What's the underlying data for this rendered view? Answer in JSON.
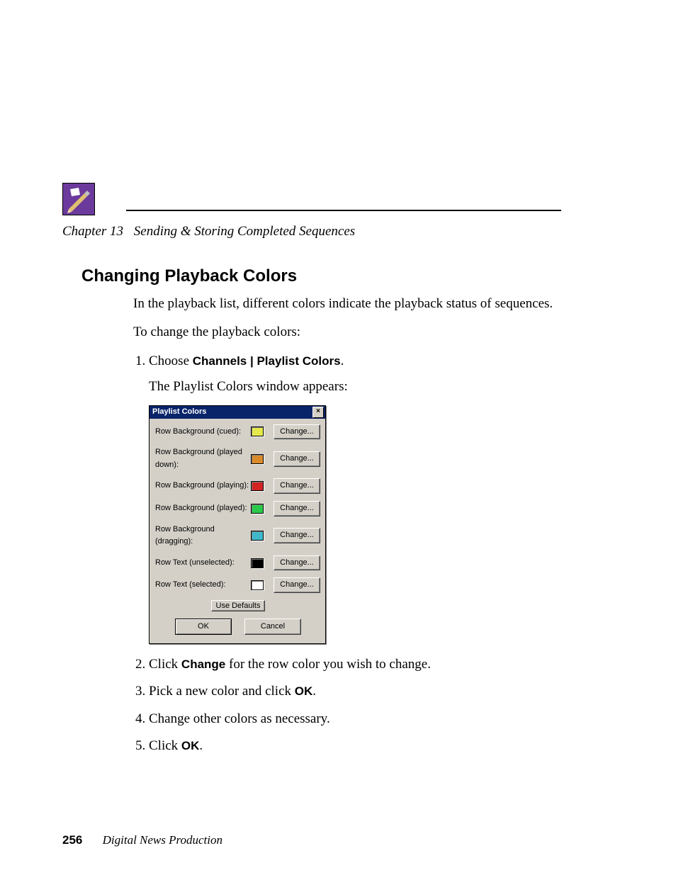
{
  "chapter": {
    "num": "Chapter 13",
    "title": "Sending & Storing Completed Sequences"
  },
  "heading": "Changing Playback Colors",
  "para1": "In the playback list, different colors indicate the playback status of sequences.",
  "para2": "To change the playback colors:",
  "steps": {
    "s1_prefix": "Choose ",
    "s1_bold": "Channels | Playlist Colors",
    "s1_suffix": ".",
    "s1_sub": "The Playlist Colors window appears:",
    "s2_prefix": "Click ",
    "s2_bold": "Change",
    "s2_suffix": " for the row color you wish to change.",
    "s3_prefix": "Pick a new color and click ",
    "s3_bold": "OK",
    "s3_suffix": ".",
    "s4": "Change other colors as necessary.",
    "s5_prefix": "Click ",
    "s5_bold": "OK",
    "s5_suffix": "."
  },
  "dialog": {
    "title": "Playlist Colors",
    "close": "×",
    "change": "Change...",
    "useDefaults": "Use Defaults",
    "ok": "OK",
    "cancel": "Cancel",
    "rows": [
      {
        "label": "Row Background (cued):",
        "color": "#e5e84a"
      },
      {
        "label": "Row Background (played down):",
        "color": "#d98b2b"
      },
      {
        "label": "Row Background (playing):",
        "color": "#d22222"
      },
      {
        "label": "Row Background (played):",
        "color": "#2ac94a"
      },
      {
        "label": "Row Background (dragging):",
        "color": "#3fb8c9"
      },
      {
        "label": "Row Text (unselected):",
        "color": "#000000"
      },
      {
        "label": "Row Text (selected):",
        "color": "#ffffff"
      }
    ]
  },
  "footer": {
    "page": "256",
    "book": "Digital News Production"
  }
}
